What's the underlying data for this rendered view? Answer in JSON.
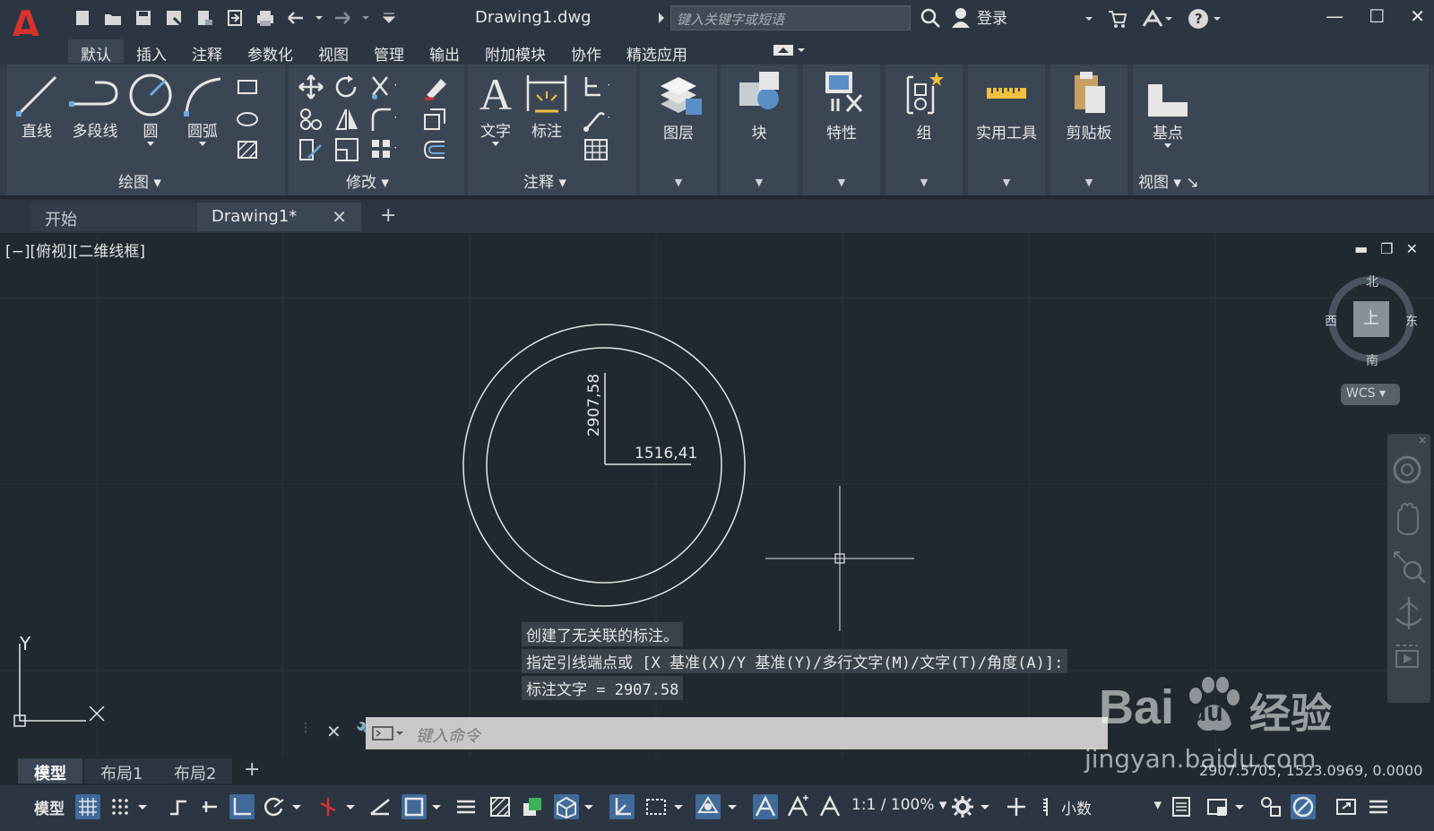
{
  "app": {
    "logo_letter": "A",
    "document_title": "Drawing1.dwg"
  },
  "titlebar": {
    "search_placeholder": "键入关键字或短语",
    "login_label": "登录"
  },
  "menu": {
    "items": [
      "默认",
      "插入",
      "注释",
      "参数化",
      "视图",
      "管理",
      "输出",
      "附加模块",
      "协作",
      "精选应用"
    ]
  },
  "ribbon": {
    "draw_tools": {
      "line": "直线",
      "polyline": "多段线",
      "circle": "圆",
      "arc": "圆弧"
    },
    "panels": {
      "draw": "绘图",
      "modify": "修改",
      "annotation": "注释",
      "view": "视图"
    },
    "annotation_tools": {
      "text": "文字",
      "dimension": "标注"
    },
    "big_buttons": {
      "layers": "图层",
      "block": "块",
      "properties": "特性",
      "group": "组",
      "utilities": "实用工具",
      "clipboard": "剪贴板",
      "basepoint": "基点"
    }
  },
  "file_tabs": {
    "start": "开始",
    "drawing": "Drawing1*"
  },
  "viewport": {
    "label": "[−][俯视][二维线框]",
    "compass": {
      "north": "北",
      "south": "南",
      "east": "东",
      "west": "西",
      "top": "上"
    },
    "wcs": "WCS",
    "dim_vertical": "2907,58",
    "dim_horizontal": "1516,41",
    "ucs_x": "X",
    "ucs_y": "Y"
  },
  "command": {
    "history": [
      "创建了无关联的标注。",
      "指定引线端点或 [X 基准(X)/Y 基准(Y)/多行文字(M)/文字(T)/角度(A)]:",
      "标注文字 = 2907.58"
    ],
    "placeholder": "键入命令"
  },
  "layout_tabs": [
    "模型",
    "布局1",
    "布局2"
  ],
  "coordinates": "2907.5705, 1523.0969, 0.0000",
  "statusbar": {
    "model_label": "模型",
    "scale": "1:1 / 100%",
    "units": "小数"
  },
  "watermark": {
    "brand": "Bai",
    "brand2": "du",
    "cn": "经验",
    "url": "jingyan.baidu.com"
  },
  "colors": {
    "background": "#212830",
    "accent": "#3f6a9a",
    "logo": "#d9322a"
  }
}
